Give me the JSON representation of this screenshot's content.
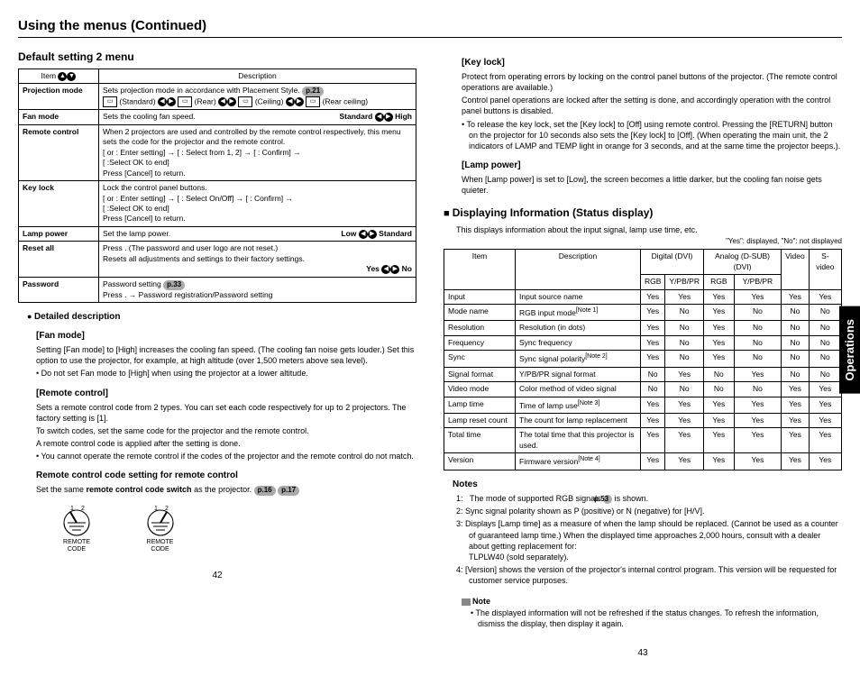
{
  "title": "Using the menus (Continued)",
  "side_tab": "Operations",
  "left": {
    "heading": "Default setting 2 menu",
    "table_head_item": "Item",
    "table_head_desc": "Description",
    "rows": [
      {
        "name": "Projection mode",
        "desc": "Sets projection mode in accordance with Placement Style.",
        "pref": "p.21",
        "extra": "(Standard)      (Rear)      (Ceiling)      (Rear ceiling)"
      },
      {
        "name": "Fan mode",
        "desc": "Sets the cooling fan speed.",
        "right": "Standard    High"
      },
      {
        "name": "Remote control",
        "desc": "When 2 projectors are used and controlled by the remote control respectively, this menu sets the code for the projector and the remote control.\n[  or  : Enter setting] → [  : Select from 1, 2] → [  : Confirm] →\n[  :Select OK to end]\nPress [Cancel] to return."
      },
      {
        "name": "Key lock",
        "desc": "Lock the control panel buttons.\n[  or  : Enter setting] → [  : Select On/Off] → [  : Confirm] →\n[  :Select OK to end]\nPress [Cancel] to return."
      },
      {
        "name": "Lamp power",
        "desc": "Set the lamp power.",
        "right": "Low    Standard"
      },
      {
        "name": "Reset all",
        "desc": "Press  . (The password and user logo are not reset.)\nResets all adjustments and settings to their factory settings.",
        "right": "Yes    No"
      },
      {
        "name": "Password",
        "desc": "Password setting",
        "pref": "p.33",
        "extra2": "Press  . → Password registration/Password setting"
      }
    ],
    "detailed": "Detailed description",
    "fan_mode_h": "[Fan mode]",
    "fan_mode_p1": "Setting [Fan mode] to [High] increases the cooling fan speed. (The cooling fan noise gets louder.) Set this option to use the projector, for example, at high altitude (over 1,500 meters above sea level).",
    "fan_mode_b1": "Do not set Fan mode to [High] when using the projector at a lower altitude.",
    "remote_h": "[Remote control]",
    "remote_p1": "Sets a remote control code from 2 types. You can set each code respectively for up to 2 projectors. The factory setting is [1].",
    "remote_p2": "To switch codes, set the same code for the projector and the remote control.",
    "remote_p3": "A remote control code is applied after the setting is done.",
    "remote_b1": "You cannot operate the remote control if the codes of the projector and the remote control do not match.",
    "rcc_h": "Remote control code setting for remote control",
    "rcc_p": "Set the same remote control code switch as the projector.",
    "rcc_pref1": "p.16",
    "rcc_pref2": "p.17",
    "remote_label": "REMOTE\nCODE",
    "page_num": "42"
  },
  "right": {
    "keylock_h": "[Key lock]",
    "keylock_p1": "Protect from operating errors by locking on the control panel buttons of the projector. (The remote control operations are available.)",
    "keylock_p2": "Control panel operations are locked after the setting is done, and accordingly operation with the control panel buttons is disabled.",
    "keylock_b1": "To release the key lock, set the [Key lock] to [Off] using remote control. Pressing the [RETURN] button on the projector for 10 seconds also sets the [Key lock] to [Off]. (When operating the main unit, the 2 indicators of LAMP and TEMP light in orange for 3 seconds, and at the same time the projector beeps.).",
    "lamp_h": "[Lamp power]",
    "lamp_p": "When [Lamp power] is set to [Low], the screen becomes a little darker, but the cooling fan noise gets quieter.",
    "disp_h": "Displaying Information (Status display)",
    "disp_p": "This displays information about the input signal, lamp use time, etc.",
    "legend": "\"Yes\": displayed, \"No\": not displayed",
    "th_item": "Item",
    "th_desc": "Description",
    "th_dvi": "Digital (DVI)",
    "th_dsub": "Analog (D-SUB)(DVI)",
    "th_video": "Video",
    "th_svideo": "S-video",
    "th_rgb": "RGB",
    "th_ypbpr": "Y/PB/PR",
    "status_rows": [
      {
        "item": "Input",
        "desc": "Input source name",
        "v": [
          "Yes",
          "Yes",
          "Yes",
          "Yes",
          "Yes",
          "Yes"
        ]
      },
      {
        "item": "Mode name",
        "desc": "RGB input mode [Note 1]",
        "v": [
          "Yes",
          "No",
          "Yes",
          "No",
          "No",
          "No"
        ]
      },
      {
        "item": "Resolution",
        "desc": "Resolution (in dots)",
        "v": [
          "Yes",
          "No",
          "Yes",
          "No",
          "No",
          "No"
        ]
      },
      {
        "item": "Frequency",
        "desc": "Sync frequency",
        "v": [
          "Yes",
          "No",
          "Yes",
          "No",
          "No",
          "No"
        ]
      },
      {
        "item": "Sync",
        "desc": "Sync signal polarity [Note 2]",
        "v": [
          "Yes",
          "No",
          "Yes",
          "No",
          "No",
          "No"
        ]
      },
      {
        "item": "Signal format",
        "desc": "Y/PB/PR signal format",
        "v": [
          "No",
          "Yes",
          "No",
          "Yes",
          "No",
          "No"
        ]
      },
      {
        "item": "Video mode",
        "desc": "Color method of video signal",
        "v": [
          "No",
          "No",
          "No",
          "No",
          "Yes",
          "Yes"
        ]
      },
      {
        "item": "Lamp time",
        "desc": "Time of lamp use [Note 3]",
        "v": [
          "Yes",
          "Yes",
          "Yes",
          "Yes",
          "Yes",
          "Yes"
        ]
      },
      {
        "item": "Lamp reset count",
        "desc": "The count for lamp replacement",
        "v": [
          "Yes",
          "Yes",
          "Yes",
          "Yes",
          "Yes",
          "Yes"
        ]
      },
      {
        "item": "Total time",
        "desc": "The total time that this projector is used.",
        "v": [
          "Yes",
          "Yes",
          "Yes",
          "Yes",
          "Yes",
          "Yes"
        ]
      },
      {
        "item": "Version",
        "desc": "Firmware version [Note 4]",
        "v": [
          "Yes",
          "Yes",
          "Yes",
          "Yes",
          "Yes",
          "Yes"
        ]
      }
    ],
    "notes_h": "Notes",
    "note1": "1:   The mode of supported RGB signals        is shown.",
    "note1_pref": "p.53",
    "note2": "2:   Sync signal polarity shown as P (positive) or N (negative) for [H/V].",
    "note3": "3:   Displays [Lamp time] as a measure of when the lamp should be replaced. (Cannot be used as a counter of guaranteed lamp time.) When the displayed time approaches 2,000 hours, consult with a dealer about getting replacement for:\nTLPLW40 (sold separately).",
    "note4": "4:   [Version] shows the version of the projector's internal control program. This version will be requested for customer service purposes.",
    "note_box_h": "Note",
    "note_box_b": "The displayed information will not be refreshed if the status changes. To refresh the information, dismiss the display, then display it again.",
    "page_num": "43"
  }
}
